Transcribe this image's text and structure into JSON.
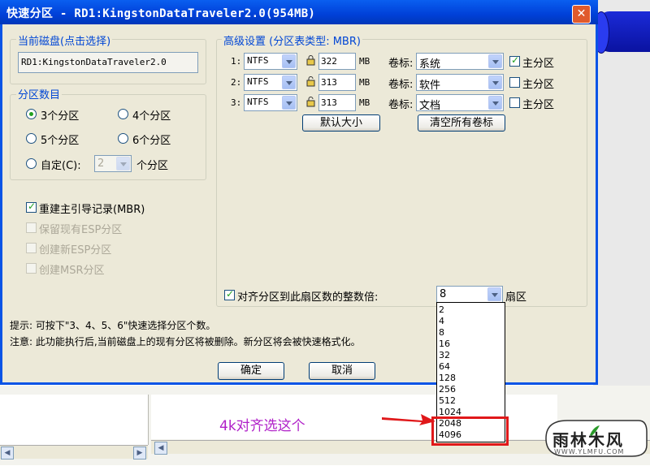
{
  "dialog": {
    "title": "快速分区 - RD1:KingstonDataTraveler2.0(954MB)",
    "close": "✕"
  },
  "disk": {
    "group_label": "当前磁盘(点击选择)",
    "value": "RD1:KingstonDataTraveler2.0"
  },
  "partition_count": {
    "group_label": "分区数目",
    "options": [
      "3个分区",
      "4个分区",
      "5个分区",
      "6个分区"
    ],
    "selected": "3个分区",
    "custom_label": "自定(C):",
    "custom_value": "2",
    "custom_suffix": "个分区"
  },
  "options": {
    "rebuild_mbr": "重建主引导记录(MBR)",
    "keep_esp": "保留现有ESP分区",
    "new_esp": "创建新ESP分区",
    "create_msr": "创建MSR分区"
  },
  "advanced": {
    "group_label": "高级设置 (分区表类型: MBR)",
    "size_unit": "MB",
    "label_prefix": "卷标:",
    "primary_label": "主分区",
    "rows": [
      {
        "num": "1:",
        "fs": "NTFS",
        "size": "322",
        "label": "系统",
        "primary": true
      },
      {
        "num": "2:",
        "fs": "NTFS",
        "size": "313",
        "label": "软件",
        "primary": false
      },
      {
        "num": "3:",
        "fs": "NTFS",
        "size": "313",
        "label": "文档",
        "primary": false
      }
    ],
    "default_size_button": "默认大小",
    "clear_labels_button": "清空所有卷标"
  },
  "align": {
    "label": "对齐分区到此扇区数的整数倍:",
    "value": "8",
    "suffix": "扇区",
    "dropdown_options": [
      "2",
      "4",
      "8",
      "16",
      "32",
      "64",
      "128",
      "256",
      "512",
      "1024",
      "2048",
      "4096"
    ]
  },
  "hints": {
    "tip": "提示: 可按下\"3、4、5、6\"快速选择分区个数。",
    "note": "注意: 此功能执行后,当前磁盘上的现有分区将被删除。新分区将会被快速格式化。"
  },
  "buttons": {
    "ok": "确定",
    "cancel": "取消"
  },
  "annotation": {
    "text": "4k对齐选这个",
    "color": "#b020c8"
  },
  "watermark": {
    "brand": "雨林木风",
    "url": "WWW.YLMFU.COM"
  },
  "colors": {
    "titlebar": "#0a5ff0",
    "group_label": "#0046d5",
    "highlight_box": "#e0181a"
  }
}
